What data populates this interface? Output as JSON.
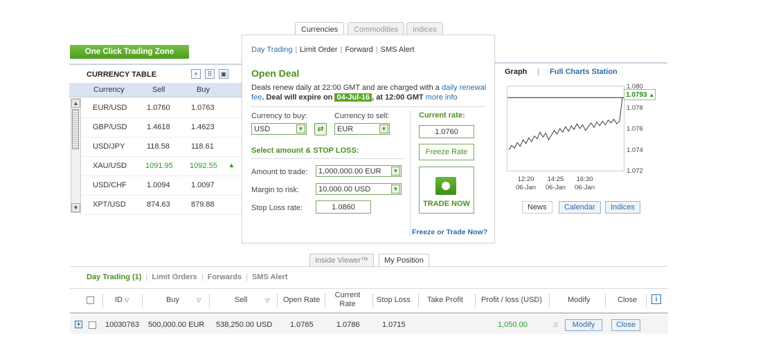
{
  "top_tabs": [
    "Currencies",
    "Commodities",
    "Indices"
  ],
  "zone_button": "One Click Trading Zone",
  "currency_table": {
    "title": "CURRENCY TABLE",
    "headers": [
      "Currency",
      "Sell",
      "Buy"
    ],
    "rows": [
      {
        "currency": "EUR/USD",
        "sell": "1.0760",
        "buy": "1.0763"
      },
      {
        "currency": "GBP/USD",
        "sell": "1.4618",
        "buy": "1.4623"
      },
      {
        "currency": "USD/JPY",
        "sell": "118.58",
        "buy": "118.61"
      },
      {
        "currency": "XAU/USD",
        "sell": "1091.95",
        "buy": "1092.55"
      },
      {
        "currency": "USD/CHF",
        "sell": "1.0094",
        "buy": "1.0097"
      },
      {
        "currency": "XPT/USD",
        "sell": "874.63",
        "buy": "879.88"
      }
    ]
  },
  "deal": {
    "sub_nav": [
      "Day Trading",
      "Limit Order",
      "Forward",
      "SMS Alert"
    ],
    "title": "Open Deal",
    "renew_text_1": "Deals renew daily at 22:00 GMT and are charged with a ",
    "renew_link": "daily renewal fee",
    "renew_text_2": ". Deal will expire on ",
    "expire_date": "04-Jul-16",
    "renew_text_3": ", at 12:00 GMT ",
    "more_info": "more info",
    "currency_buy_label": "Currency to buy:",
    "currency_buy": "USD",
    "currency_sell_label": "Currency to sell:",
    "currency_sell": "EUR",
    "amount_section": "Select amount & STOP LOSS:",
    "amount_label": "Amount to trade:",
    "amount_value": "1,000,000.00 EUR",
    "margin_label": "Margin to risk:",
    "margin_value": "10,000.00 USD",
    "stop_loss_label": "Stop Loss rate:",
    "stop_loss_value": "1.0860",
    "current_rate_label": "Current rate:",
    "current_rate": "1.0760",
    "freeze_rate": "Freeze Rate",
    "trade_now": "TRADE NOW",
    "freeze_or_trade": "Freeze or Trade Now?"
  },
  "chart_panel": {
    "graph_tab": "Graph",
    "full_charts": "Full Charts Station",
    "current_value": "1.0793",
    "y_ticks": [
      "1.080",
      "1.078",
      "1.076",
      "1.074",
      "1.072"
    ],
    "x_ticks": [
      {
        "time": "12:20",
        "date": "06-Jan"
      },
      {
        "time": "14:25",
        "date": "06-Jan"
      },
      {
        "time": "16:30",
        "date": "06-Jan"
      }
    ],
    "bottom_tabs": [
      "News",
      "Calendar",
      "Indices"
    ]
  },
  "chart_data": {
    "type": "line",
    "ylim": [
      1.0715,
      1.0805
    ],
    "y_values": [
      1.0737,
      1.0742,
      1.0739,
      1.0745,
      1.0741,
      1.0748,
      1.0744,
      1.075,
      1.0746,
      1.0752,
      1.0749,
      1.0756,
      1.0751,
      1.0755,
      1.0748,
      1.0753,
      1.0758,
      1.0754,
      1.076,
      1.0756,
      1.0762,
      1.0757,
      1.0763,
      1.0759,
      1.0765,
      1.076,
      1.0764,
      1.0758,
      1.0762,
      1.0766,
      1.0761,
      1.0767,
      1.0763,
      1.0768,
      1.0764,
      1.0769,
      1.0766,
      1.077,
      1.0765,
      1.0768,
      1.0793
    ],
    "reference_value": 1.0793
  },
  "bottom": {
    "tabs": [
      "Inside Viewer™",
      "My Position"
    ],
    "nav": [
      "Day Trading (1)",
      "Limit Orders",
      "Forwards",
      "SMS Alert"
    ],
    "headers": [
      "ID",
      "Buy",
      "Sell",
      "Open Rate",
      "Current Rate",
      "Stop Loss",
      "Take Profit",
      "Profit / loss (USD)",
      "Modify",
      "Close"
    ],
    "row": {
      "id": "10030763",
      "buy": "500,000.00 EUR",
      "sell": "538,250.00 USD",
      "open_rate": "1.0765",
      "current_rate": "1.0786",
      "stop_loss": "1.0715",
      "take_profit": "",
      "profit_loss": "1,050.00",
      "modify": "Modify",
      "close": "Close"
    }
  }
}
